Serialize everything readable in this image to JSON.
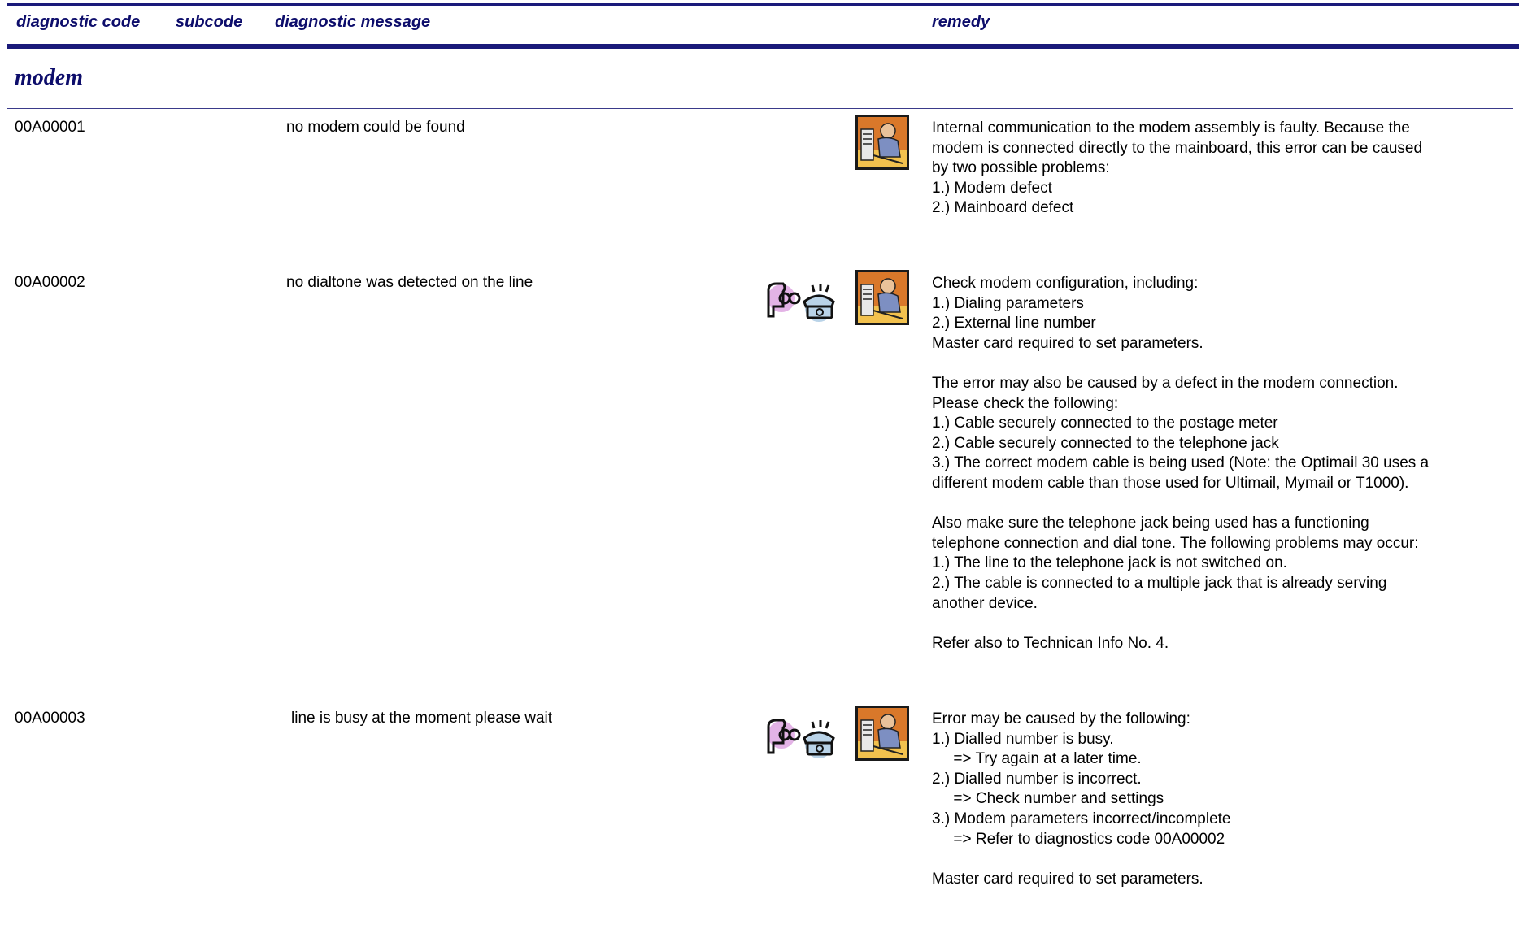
{
  "table_header": {
    "diagnostic_code": "diagnostic code",
    "subcode": "subcode",
    "diagnostic_message": "diagnostic message",
    "remedy": "remedy"
  },
  "section": {
    "title": "modem"
  },
  "rows": [
    {
      "code": "00A00001",
      "message": "no modem could be found",
      "icons": [
        "technician-icon"
      ],
      "remedy": [
        "Internal communication to the modem assembly is faulty. Because the",
        "modem is connected directly to the mainboard, this error can be caused",
        "by two possible problems:",
        "1.) Modem defect",
        "2.) Mainboard defect"
      ]
    },
    {
      "code": "00A00002",
      "message": "no dialtone was detected on the line",
      "icons": [
        "user-phone-icon",
        "technician-icon"
      ],
      "remedy": [
        "Check modem configuration, including:",
        "1.) Dialing parameters",
        "2.) External line number",
        "Master card required to set parameters.",
        "",
        "The error may also be caused by a defect in the modem connection.",
        "Please check the following:",
        "1.) Cable securely connected to the postage meter",
        "2.) Cable securely connected to the telephone jack",
        "3.) The correct modem cable is being used (Note: the Optimail 30 uses a",
        "different modem cable than those used for Ultimail, Mymail or T1000).",
        "",
        "Also make sure the telephone jack being used has a functioning",
        "telephone connection and dial tone. The following problems may occur:",
        "1.) The line to the telephone jack is not switched on.",
        "2.) The cable is connected to a multiple jack that is already serving",
        "another device.",
        "",
        "Refer also to Technican Info No. 4."
      ]
    },
    {
      "code": "00A00003",
      "message": "line is busy at the moment please wait",
      "icons": [
        "user-phone-icon",
        "technician-icon"
      ],
      "remedy": [
        "Error may be caused by the following:",
        "1.) Dialled number is busy.",
        "     => Try again at a later time.",
        "2.) Dialled number is incorrect.",
        "     => Check number and settings",
        "3.) Modem parameters incorrect/incomplete",
        "     => Refer to diagnostics code 00A00002",
        "",
        "Master card required to set parameters."
      ]
    }
  ]
}
